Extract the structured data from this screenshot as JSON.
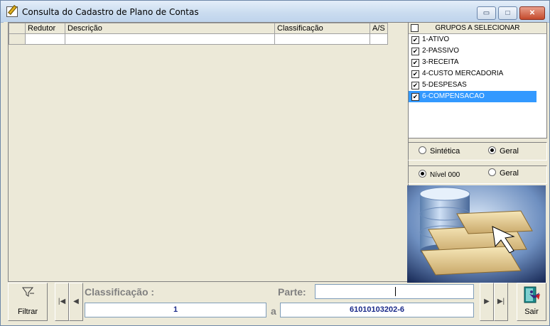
{
  "window": {
    "title": "Consulta do Cadastro de Plano de Contas",
    "controls": {
      "minimize": "▭",
      "maximize": "□",
      "close": "✕"
    }
  },
  "grid": {
    "columns": [
      "",
      "Redutor",
      "Descrição",
      "Classificação",
      "A/S"
    ],
    "rows": [
      [
        "",
        "",
        "",
        "",
        ""
      ]
    ]
  },
  "groups": {
    "header": "GRUPOS A SELECIONAR",
    "items": [
      {
        "label": "1-ATIVO",
        "checked": true
      },
      {
        "label": "2-PASSIVO",
        "checked": true
      },
      {
        "label": "3-RECEITA",
        "checked": true
      },
      {
        "label": "4-CUSTO MERCADORIA",
        "checked": true
      },
      {
        "label": "5-DESPESAS",
        "checked": true
      },
      {
        "label": "6-COMPENSACAO",
        "checked": true,
        "selected": true
      }
    ]
  },
  "options1": {
    "sintetica": "Sintética",
    "geral": "Geral",
    "selected": "geral"
  },
  "options2": {
    "nivel": "Nível 000",
    "geral": "Geral",
    "selected": "nivel"
  },
  "bottom": {
    "filtrar": "Filtrar",
    "classificacao_label": "Classificação :",
    "parte_label": "Parte:",
    "a_label": "a",
    "from_value": "1",
    "to_value": "61010103202-6",
    "parte_value": "",
    "sair": "Sair"
  },
  "icons": {
    "filter": "filter-icon",
    "first": "first-record-icon",
    "prev": "previous-record-icon",
    "next": "next-record-icon",
    "last": "last-record-icon",
    "exit": "exit-door-icon"
  },
  "colors": {
    "selection": "#3399ff",
    "value_text": "#1a2a8a",
    "label_gray": "#808080"
  }
}
